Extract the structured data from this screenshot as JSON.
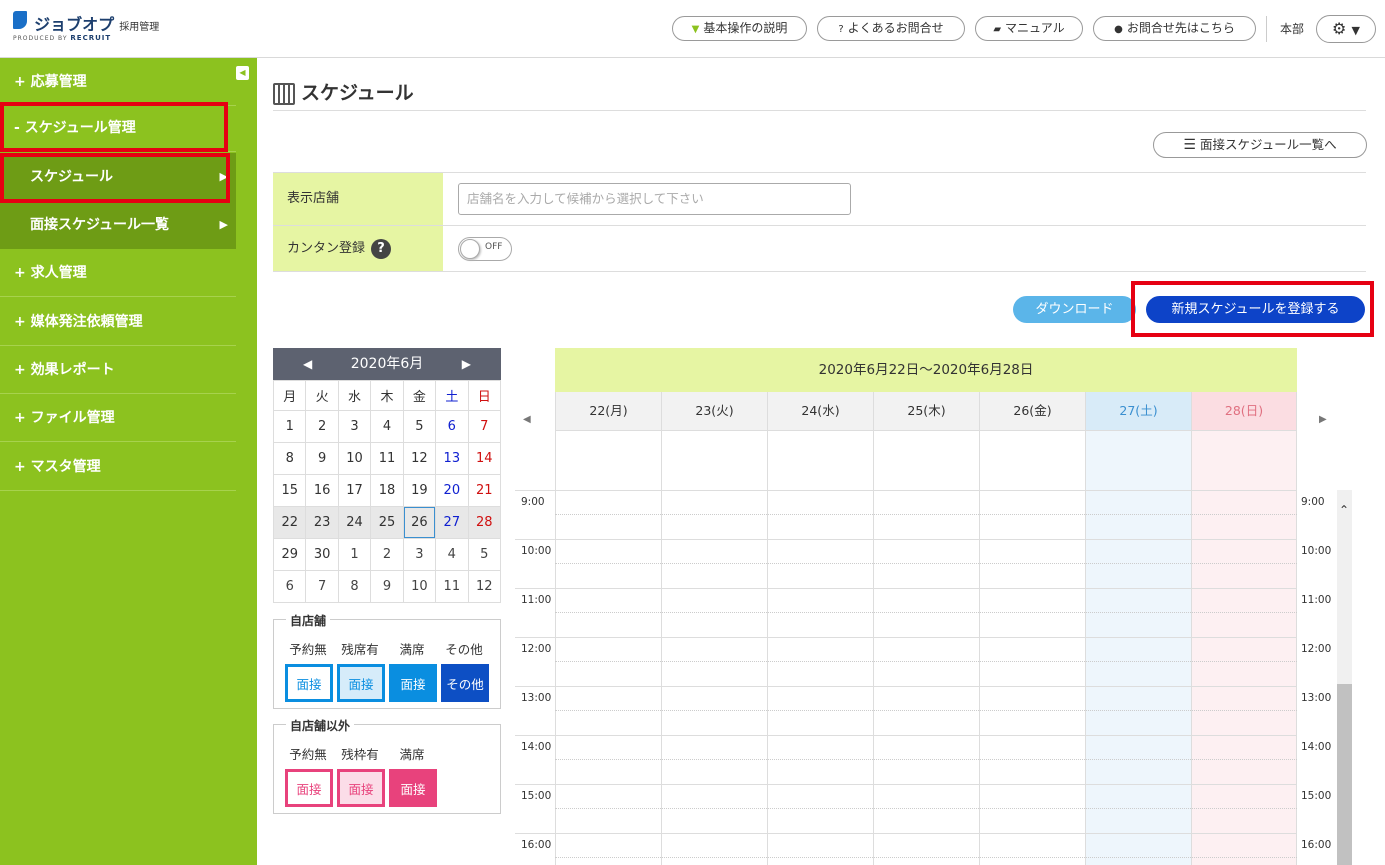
{
  "header": {
    "logo_name": "ジョブオプ",
    "logo_sub": "採用管理",
    "produced_by": "PRODUCED BY",
    "recruit": "RECRUIT",
    "buttons": [
      {
        "label": "基本操作の説明",
        "icon": "beginner-mark-icon"
      },
      {
        "label": "よくあるお問合せ",
        "icon": "question-circle-icon"
      },
      {
        "label": "マニュアル",
        "icon": "book-icon"
      },
      {
        "label": "お問合せ先はこちら",
        "icon": "chat-bubble-icon"
      }
    ],
    "user": "本部",
    "settings_icon": "gear-icon"
  },
  "sidebar": {
    "items": [
      {
        "label": "+ 応募管理"
      },
      {
        "label": "- スケジュール管理"
      },
      {
        "label": "スケジュール"
      },
      {
        "label": "面接スケジュール一覧"
      },
      {
        "label": "+ 求人管理"
      },
      {
        "label": "+ 媒体発注依頼管理"
      },
      {
        "label": "+ 効果レポート"
      },
      {
        "label": "+ ファイル管理"
      },
      {
        "label": "+ マスタ管理"
      }
    ]
  },
  "main": {
    "title": "スケジュール",
    "list_link": "面接スケジュール一覧へ",
    "store_label": "表示店舗",
    "store_placeholder": "店舗名を入力して候補から選択して下さい",
    "easy_label": "カンタン登録",
    "toggle_text": "OFF",
    "download_label": "ダウンロード",
    "new_label": "新規スケジュールを登録する"
  },
  "minical": {
    "month": "2020年6月",
    "dow": [
      "月",
      "火",
      "水",
      "木",
      "金",
      "土",
      "日"
    ],
    "weeks": [
      [
        "1",
        "2",
        "3",
        "4",
        "5",
        "6",
        "7"
      ],
      [
        "8",
        "9",
        "10",
        "11",
        "12",
        "13",
        "14"
      ],
      [
        "15",
        "16",
        "17",
        "18",
        "19",
        "20",
        "21"
      ],
      [
        "22",
        "23",
        "24",
        "25",
        "26",
        "27",
        "28"
      ],
      [
        "29",
        "30",
        "1",
        "2",
        "3",
        "4",
        "5"
      ],
      [
        "6",
        "7",
        "8",
        "9",
        "10",
        "11",
        "12"
      ]
    ],
    "today": "26"
  },
  "legend_own": {
    "title": "自店舗",
    "labels": [
      "予約無",
      "残席有",
      "満席",
      "その他"
    ],
    "boxes": [
      "面接",
      "面接",
      "面接",
      "その他"
    ]
  },
  "legend_other": {
    "title": "自店舗以外",
    "labels": [
      "予約無",
      "残枠有",
      "満席"
    ],
    "boxes": [
      "面接",
      "面接",
      "面接"
    ]
  },
  "week": {
    "title": "2020年6月22日～2020年6月28日",
    "days": [
      "22(月)",
      "23(火)",
      "24(水)",
      "25(木)",
      "26(金)",
      "27(土)",
      "28(日)"
    ],
    "times": [
      "9:00",
      "10:00",
      "11:00",
      "12:00",
      "13:00",
      "14:00",
      "15:00",
      "16:00"
    ]
  },
  "colors": {
    "sidebar": "#8cc21f",
    "label_bg": "#e6f5a3",
    "primary": "#0d43c8",
    "download": "#5bb5e9",
    "highlight": "#e60012"
  }
}
